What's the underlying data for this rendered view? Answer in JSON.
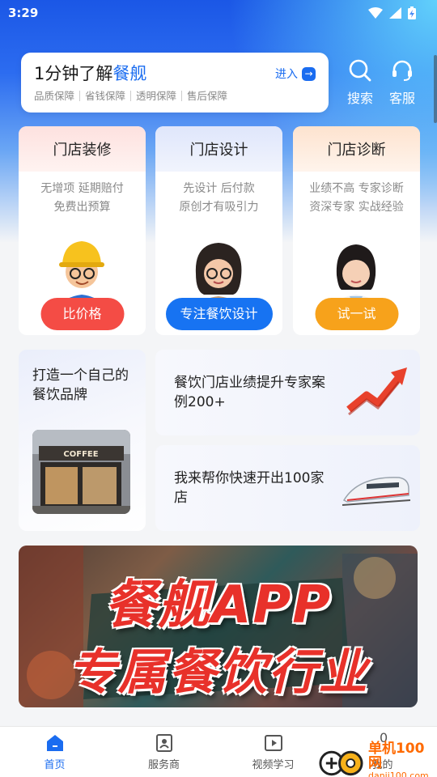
{
  "status_bar": {
    "time": "3:29"
  },
  "search_card": {
    "title_prefix": "1分钟了解",
    "title_highlight": "餐舰",
    "enter_label": "进入",
    "tags": [
      "品质保障",
      "省钱保障",
      "透明保障",
      "售后保障"
    ]
  },
  "top_actions": {
    "search_label": "搜索",
    "service_label": "客服"
  },
  "service_cards": [
    {
      "title": "门店装修",
      "line1": "无增项 延期赔付",
      "line2": "免费出预算",
      "button": "比价格",
      "color": "#f44c45",
      "head_bg": "#fde1df"
    },
    {
      "title": "门店设计",
      "line1": "先设计 后付款",
      "line2": "原创才有吸引力",
      "button": "专注餐饮设计",
      "color": "#1773f2",
      "head_bg": "#e2e8fb"
    },
    {
      "title": "门店诊断",
      "line1": "业绩不高 专家诊断",
      "line2": "资深专家 实战经验",
      "button": "试一试",
      "color": "#f7a21b",
      "head_bg": "#fde7d6"
    }
  ],
  "brand_card": {
    "text": "打造一个自己的餐饮品牌",
    "image_caption": "COFFEE"
  },
  "promo_cards": [
    {
      "text": "餐饮门店业绩提升专家案例200+"
    },
    {
      "text": "我来帮你快速开出100家店"
    }
  ],
  "banner": {
    "line1": "餐舰APP",
    "line2": "专属餐饮行业"
  },
  "bottom_nav": {
    "items": [
      {
        "label": "首页",
        "icon": "home-icon"
      },
      {
        "label": "服务商",
        "icon": "id-card-icon"
      },
      {
        "label": "视频学习",
        "icon": "play-icon"
      },
      {
        "label": "我的",
        "icon": "user-icon"
      }
    ],
    "badge": "0"
  },
  "watermark": {
    "text": "单机100网",
    "sub": "danji100.com"
  },
  "colors": {
    "accent": "#1a6cf0",
    "red": "#f44c45",
    "orange": "#f7a21b"
  }
}
